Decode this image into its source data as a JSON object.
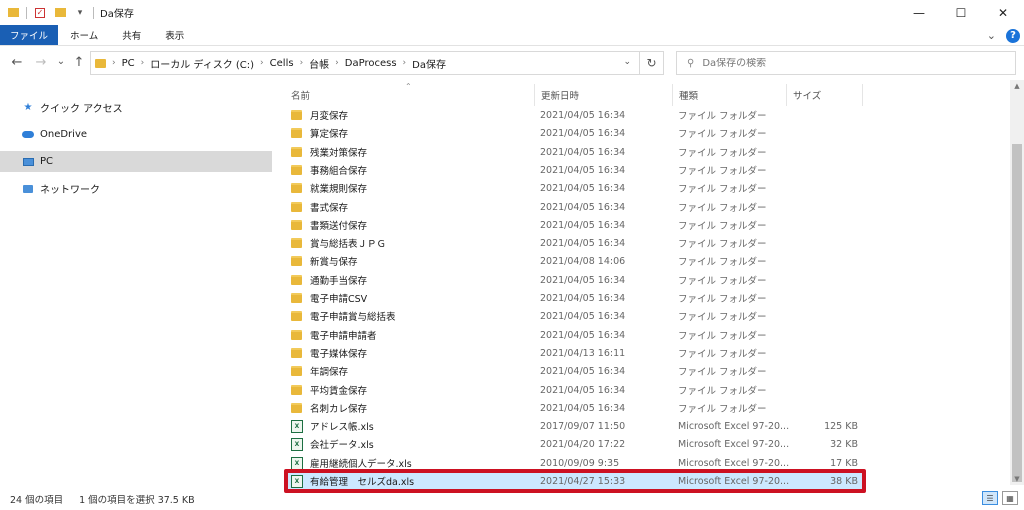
{
  "window": {
    "title": "Da保存",
    "controls": {
      "minimize": "—",
      "maximize": "☐",
      "close": "✕"
    }
  },
  "ribbon": {
    "tabs": [
      "ファイル",
      "ホーム",
      "共有",
      "表示"
    ],
    "help": "?",
    "expand": "⌄"
  },
  "nav": {
    "back": "←",
    "forward": "→",
    "recent": "⌄",
    "up": "↑",
    "refresh": "↻"
  },
  "address": {
    "crumbs": [
      "PC",
      "ローカル ディスク (C:)",
      "Cells",
      "台帳",
      "DaProcess",
      "Da保存"
    ]
  },
  "search": {
    "placeholder": "Da保存の検索"
  },
  "sidebar": {
    "items": [
      {
        "label": "クイック アクセス",
        "icon": "star-icon"
      },
      {
        "label": "OneDrive",
        "icon": "cloud-icon"
      },
      {
        "label": "PC",
        "icon": "computer-icon"
      },
      {
        "label": "ネットワーク",
        "icon": "network-icon"
      }
    ]
  },
  "columns": {
    "name": "名前",
    "date": "更新日時",
    "type": "種類",
    "size": "サイズ"
  },
  "files": [
    {
      "name": "月変保存",
      "date": "2021/04/05 16:34",
      "type": "ファイル フォルダー",
      "size": "",
      "kind": "folder"
    },
    {
      "name": "算定保存",
      "date": "2021/04/05 16:34",
      "type": "ファイル フォルダー",
      "size": "",
      "kind": "folder"
    },
    {
      "name": "残業対策保存",
      "date": "2021/04/05 16:34",
      "type": "ファイル フォルダー",
      "size": "",
      "kind": "folder"
    },
    {
      "name": "事務組合保存",
      "date": "2021/04/05 16:34",
      "type": "ファイル フォルダー",
      "size": "",
      "kind": "folder"
    },
    {
      "name": "就業規則保存",
      "date": "2021/04/05 16:34",
      "type": "ファイル フォルダー",
      "size": "",
      "kind": "folder"
    },
    {
      "name": "書式保存",
      "date": "2021/04/05 16:34",
      "type": "ファイル フォルダー",
      "size": "",
      "kind": "folder"
    },
    {
      "name": "書類送付保存",
      "date": "2021/04/05 16:34",
      "type": "ファイル フォルダー",
      "size": "",
      "kind": "folder"
    },
    {
      "name": "賞与総括表ＪＰＧ",
      "date": "2021/04/05 16:34",
      "type": "ファイル フォルダー",
      "size": "",
      "kind": "folder"
    },
    {
      "name": "新賞与保存",
      "date": "2021/04/08 14:06",
      "type": "ファイル フォルダー",
      "size": "",
      "kind": "folder"
    },
    {
      "name": "通勤手当保存",
      "date": "2021/04/05 16:34",
      "type": "ファイル フォルダー",
      "size": "",
      "kind": "folder"
    },
    {
      "name": "電子申請CSV",
      "date": "2021/04/05 16:34",
      "type": "ファイル フォルダー",
      "size": "",
      "kind": "folder"
    },
    {
      "name": "電子申請賞与総括表",
      "date": "2021/04/05 16:34",
      "type": "ファイル フォルダー",
      "size": "",
      "kind": "folder"
    },
    {
      "name": "電子申請申請者",
      "date": "2021/04/05 16:34",
      "type": "ファイル フォルダー",
      "size": "",
      "kind": "folder"
    },
    {
      "name": "電子媒体保存",
      "date": "2021/04/13 16:11",
      "type": "ファイル フォルダー",
      "size": "",
      "kind": "folder"
    },
    {
      "name": "年調保存",
      "date": "2021/04/05 16:34",
      "type": "ファイル フォルダー",
      "size": "",
      "kind": "folder"
    },
    {
      "name": "平均賃金保存",
      "date": "2021/04/05 16:34",
      "type": "ファイル フォルダー",
      "size": "",
      "kind": "folder"
    },
    {
      "name": "名刺カレ保存",
      "date": "2021/04/05 16:34",
      "type": "ファイル フォルダー",
      "size": "",
      "kind": "folder"
    },
    {
      "name": "アドレス帳.xls",
      "date": "2017/09/07 11:50",
      "type": "Microsoft Excel 97-20...",
      "size": "125 KB",
      "kind": "excel"
    },
    {
      "name": "会社データ.xls",
      "date": "2021/04/20 17:22",
      "type": "Microsoft Excel 97-20...",
      "size": "32 KB",
      "kind": "excel"
    },
    {
      "name": "雇用継続個人データ.xls",
      "date": "2010/09/09 9:35",
      "type": "Microsoft Excel 97-20...",
      "size": "17 KB",
      "kind": "excel"
    },
    {
      "name": "有給管理　セルズda.xls",
      "date": "2021/04/27 15:33",
      "type": "Microsoft Excel 97-20...",
      "size": "38 KB",
      "kind": "excel",
      "selected": true
    }
  ],
  "status": {
    "count": "24 個の項目",
    "selection": "1 個の項目を選択 37.5 KB"
  },
  "colors": {
    "selection": "#cce8ff",
    "highlight_border": "#cc1122",
    "file_tab": "#1a5fb4"
  }
}
